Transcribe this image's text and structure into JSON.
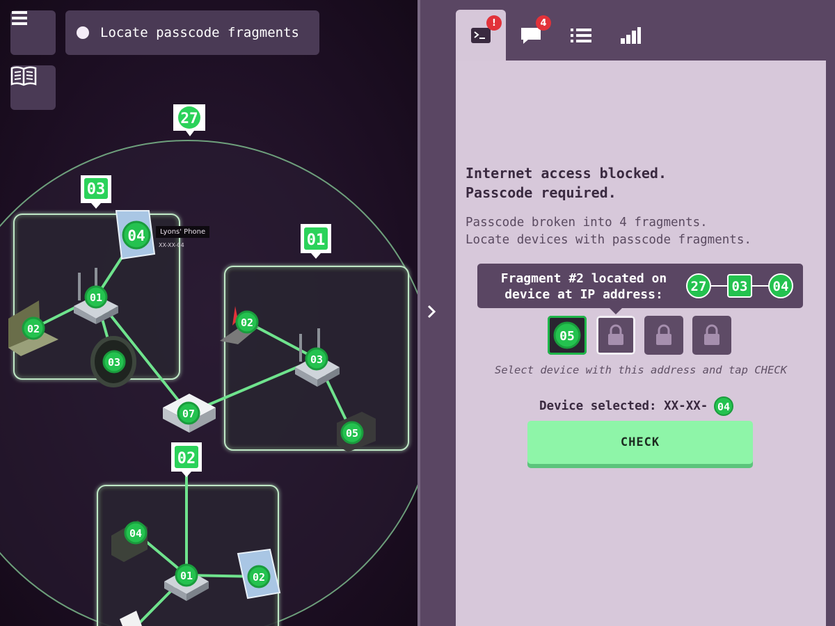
{
  "objective": {
    "text": "Locate passcode fragments"
  },
  "icons": {
    "menu": "menu-icon",
    "book": "book-icon",
    "terminal": "terminal-icon",
    "chat": "chat-icon",
    "list": "list-icon",
    "stats": "stats-icon",
    "collapse": "chevron-right-icon"
  },
  "tabs": [
    {
      "name": "terminal",
      "badge": "!"
    },
    {
      "name": "chat",
      "badge": "4"
    },
    {
      "name": "list",
      "badge": ""
    },
    {
      "name": "stats",
      "badge": ""
    }
  ],
  "terminal": {
    "blocked_lines": "Internet access blocked.\nPasscode required.",
    "info_lines": "Passcode broken into 4 fragments.\nLocate devices with passcode fragments.",
    "fragment_tooltip": "Fragment #2 located on\ndevice at IP address:",
    "ip_parts": [
      "27",
      "03",
      "04"
    ],
    "found_fragment": "05",
    "hint": "Select device with this address and tap CHECK",
    "selected_label": "Device selected: XX-XX-",
    "selected_id": "04",
    "check_label": "CHECK"
  },
  "map": {
    "network_markers": {
      "root": "27",
      "left": "03",
      "right": "01",
      "bottom": "02"
    },
    "device_label": "Lyons' Phone",
    "device_ip": "XX-XX-04",
    "nodes": {
      "l_phone": "04",
      "l_router": "01",
      "l_laptop": "02",
      "l_watch": "03",
      "hub": "07",
      "r_camera": "02",
      "r_router": "03",
      "r_laptop": "05",
      "b_monitor": "04",
      "b_router": "01",
      "b_tablet": "02"
    }
  },
  "colors": {
    "accent": "#2bd25a",
    "node": "#24c24f",
    "panel": "#d7c8da",
    "sidebar": "#5a4663",
    "check": "#8ef5a8",
    "badge": "#e2323a"
  }
}
